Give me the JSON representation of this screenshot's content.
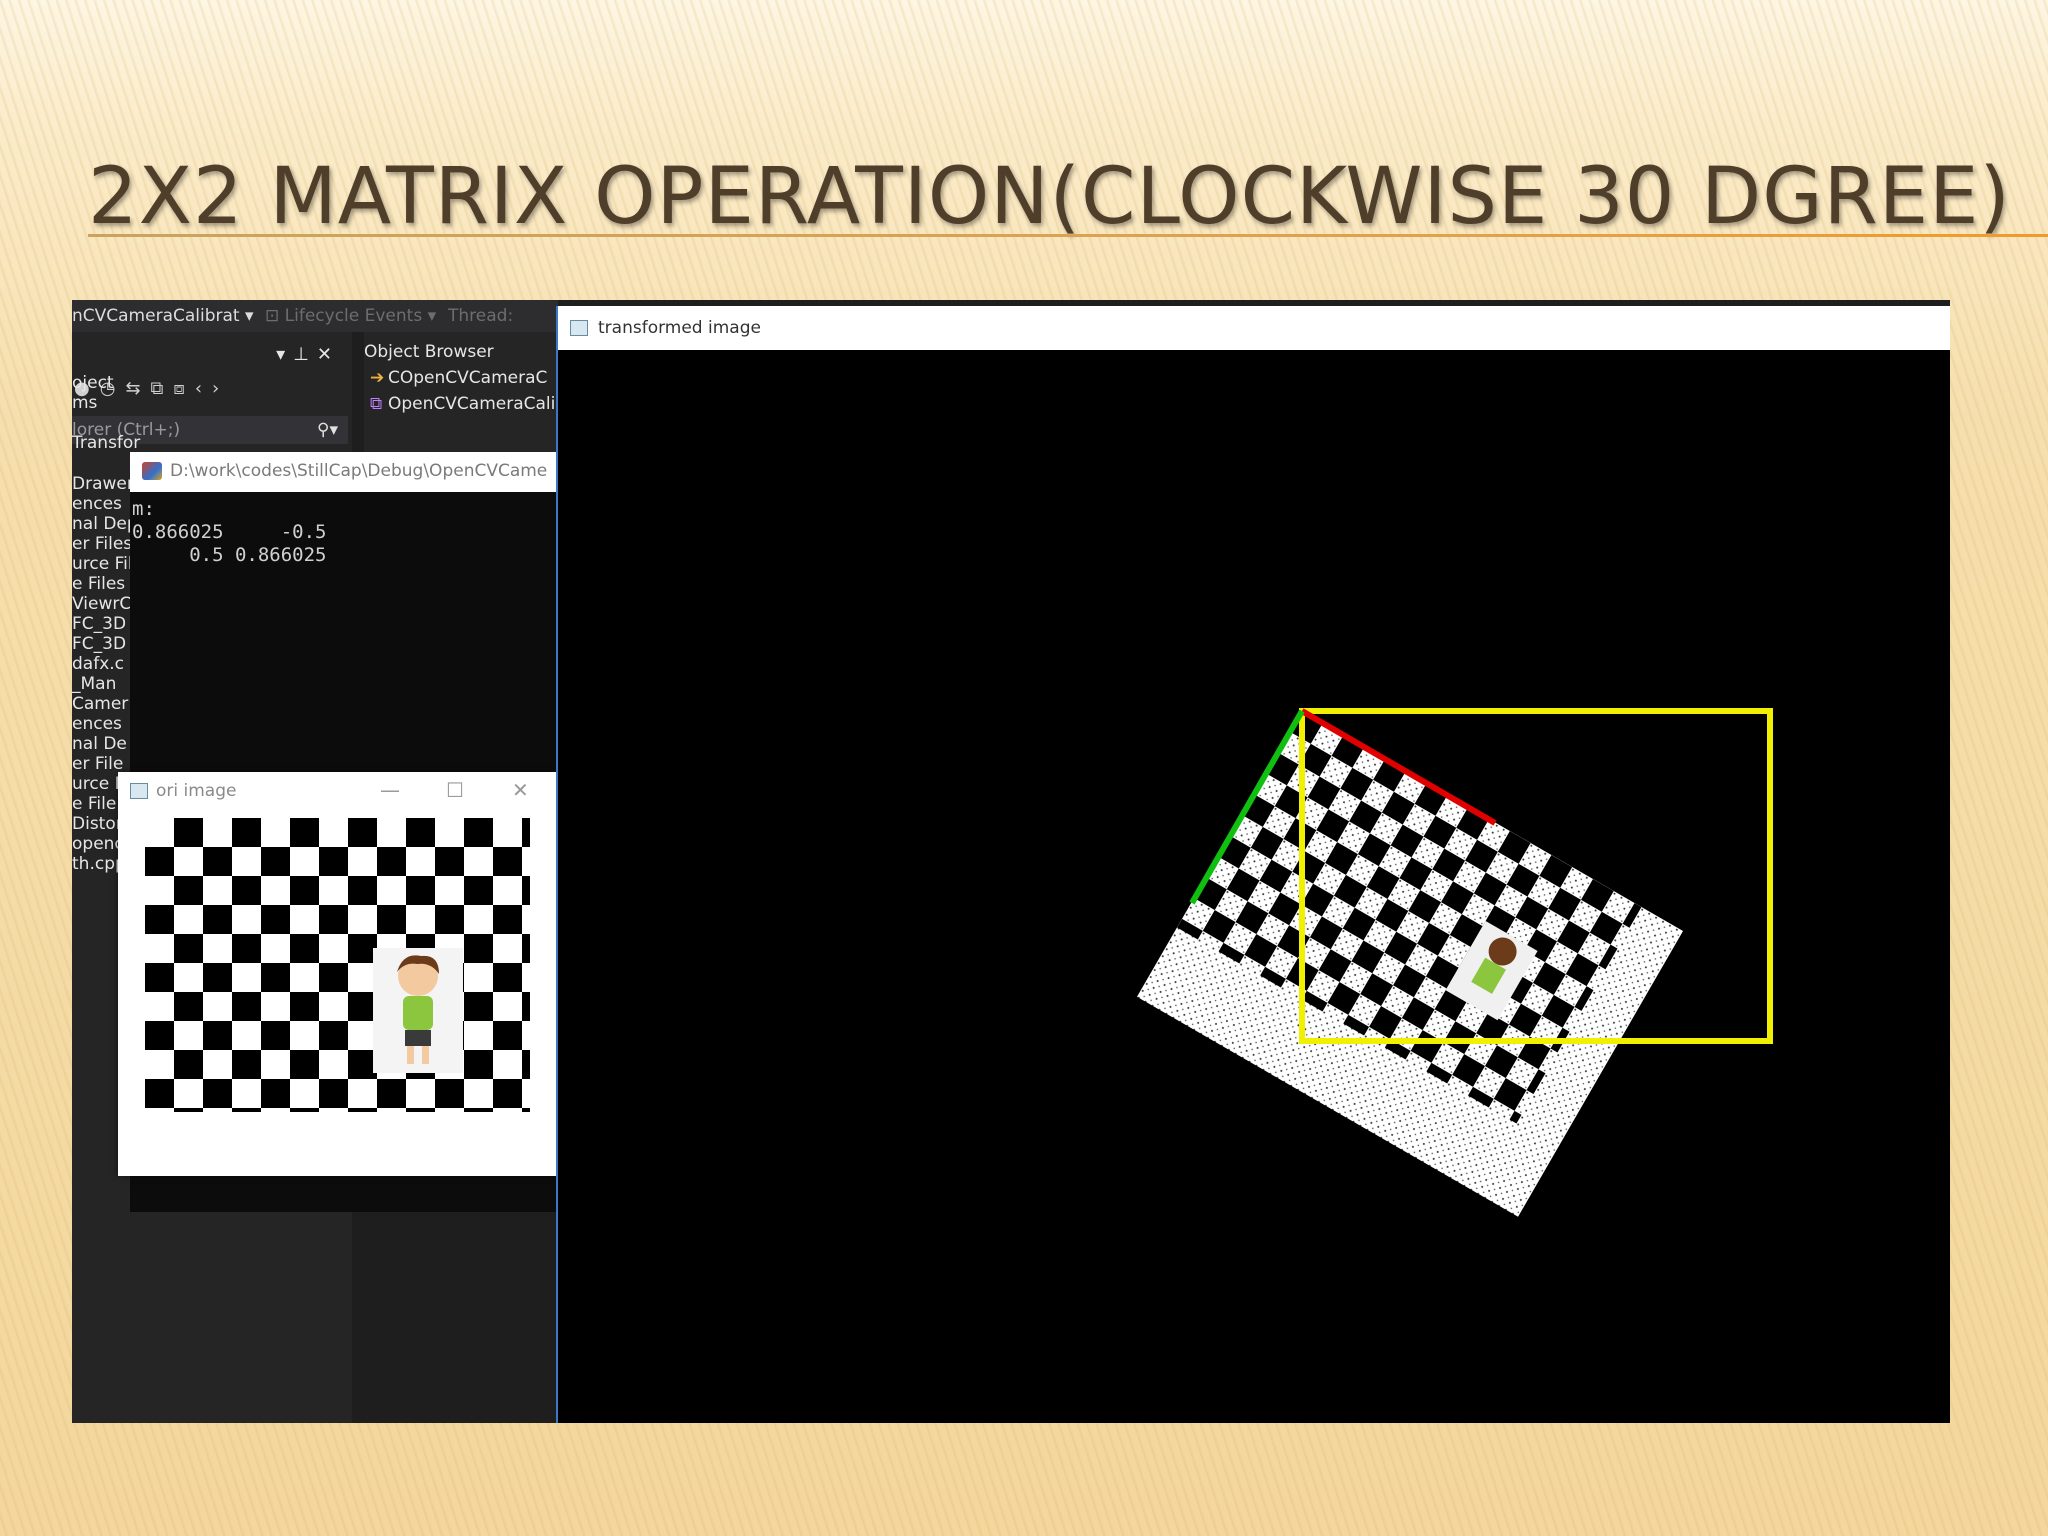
{
  "slide": {
    "title": "2X2 MATRIX OPERATION(CLOCKWISE 30 DGREE)"
  },
  "ide": {
    "toolbar": {
      "project_combo": "nCVCameraCalibrat ▾",
      "lifecycle": "⊡ Lifecycle Events ▾",
      "thread": "Thread:"
    },
    "search_placeholder": "lorer (Ctrl+;)",
    "tree_items": [
      "oject",
      "ms",
      "Transfor",
      "Drawer",
      "ences",
      "nal Dep",
      "er Files",
      "urce File",
      "e Files",
      "ViewrC",
      "FC_3D",
      "FC_3D",
      "dafx.c",
      "_Man",
      "Camer",
      "ences",
      "nal De",
      "er File",
      "urce F",
      "e File",
      "Distor",
      "opencv",
      "th.cpp"
    ],
    "object_browser": {
      "tab": "Object Browser",
      "items": [
        "COpenCVCameraC",
        "OpenCVCameraCali"
      ]
    }
  },
  "console": {
    "path": "D:\\work\\codes\\StillCap\\Debug\\OpenCVCame",
    "output": "m:\n0.866025     -0.5\n     0.5 0.866025"
  },
  "ori_window": {
    "title": "ori image"
  },
  "transformed_window": {
    "title": "transformed image"
  },
  "colors": {
    "x_axis": "#e00000",
    "y_axis": "#10c010",
    "bounding_box": "#f0f000"
  }
}
